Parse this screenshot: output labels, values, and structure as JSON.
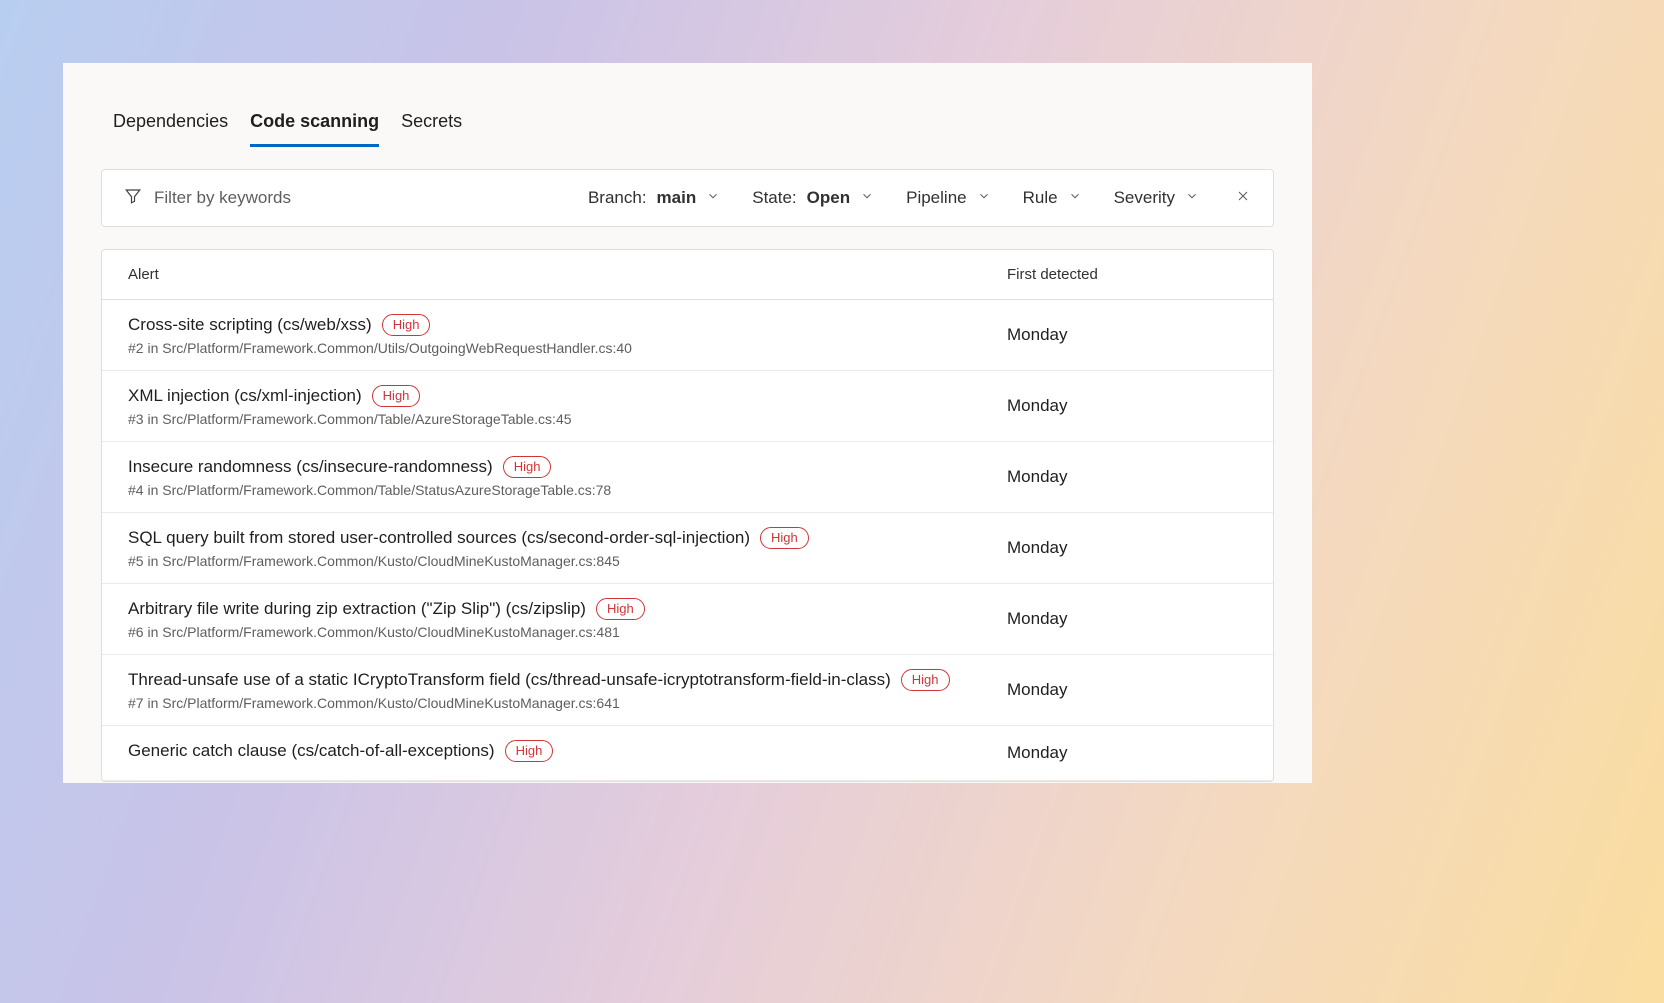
{
  "tabs": [
    {
      "label": "Dependencies",
      "active": false
    },
    {
      "label": "Code scanning",
      "active": true
    },
    {
      "label": "Secrets",
      "active": false
    }
  ],
  "filter": {
    "placeholder": "Filter by keywords",
    "branch": {
      "label": "Branch:",
      "value": "main"
    },
    "state": {
      "label": "State:",
      "value": "Open"
    },
    "pipeline": {
      "label": "Pipeline"
    },
    "rule": {
      "label": "Rule"
    },
    "severity": {
      "label": "Severity"
    }
  },
  "columns": {
    "alert": "Alert",
    "first_detected": "First detected"
  },
  "alerts": [
    {
      "title": "Cross-site scripting (cs/web/xss)",
      "severity": "High",
      "sub": "#2 in Src/Platform/Framework.Common/Utils/OutgoingWebRequestHandler.cs:40",
      "detected": "Monday"
    },
    {
      "title": "XML injection (cs/xml-injection)",
      "severity": "High",
      "sub": "#3 in Src/Platform/Framework.Common/Table/AzureStorageTable.cs:45",
      "detected": "Monday"
    },
    {
      "title": "Insecure randomness (cs/insecure-randomness)",
      "severity": "High",
      "sub": "#4 in Src/Platform/Framework.Common/Table/StatusAzureStorageTable.cs:78",
      "detected": "Monday"
    },
    {
      "title": "SQL query built from stored user-controlled sources (cs/second-order-sql-injection)",
      "severity": "High",
      "sub": "#5 in Src/Platform/Framework.Common/Kusto/CloudMineKustoManager.cs:845",
      "detected": "Monday"
    },
    {
      "title": "Arbitrary file write during zip extraction (\"Zip Slip\") (cs/zipslip)",
      "severity": "High",
      "sub": "#6 in Src/Platform/Framework.Common/Kusto/CloudMineKustoManager.cs:481",
      "detected": "Monday"
    },
    {
      "title": "Thread-unsafe use of a static ICryptoTransform field (cs/thread-unsafe-icryptotransform-field-in-class)",
      "severity": "High",
      "sub": "#7 in Src/Platform/Framework.Common/Kusto/CloudMineKustoManager.cs:641",
      "detected": "Monday"
    },
    {
      "title": "Generic catch clause (cs/catch-of-all-exceptions)",
      "severity": "High",
      "sub": "",
      "detected": "Monday"
    }
  ]
}
